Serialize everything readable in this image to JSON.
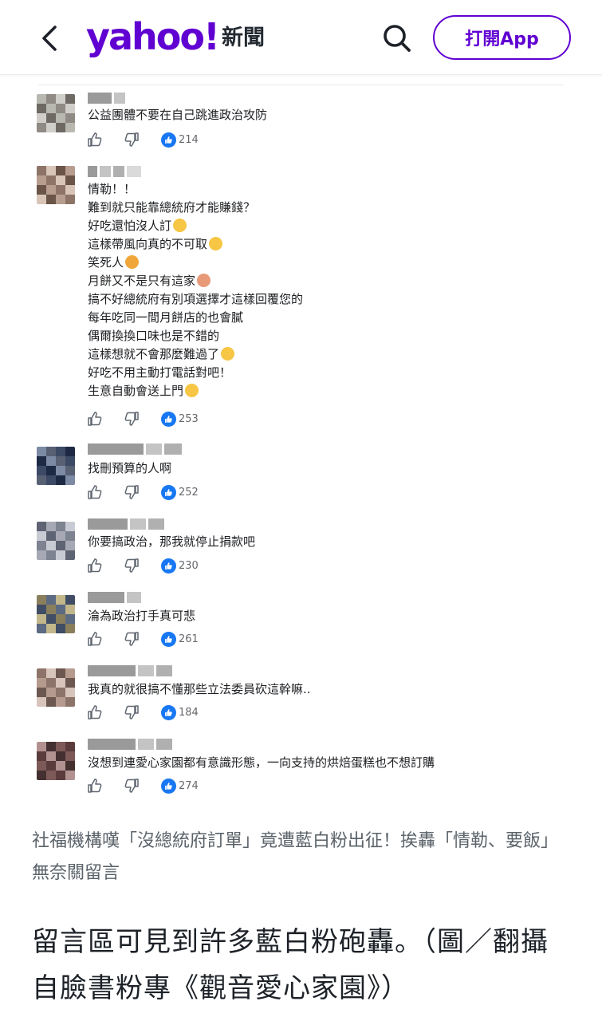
{
  "header": {
    "logo_text": "yahoo!",
    "logo_suffix": "新聞",
    "open_app_label": "打開App",
    "brand_color": "#6001d2",
    "icons": [
      "chevron-left-icon",
      "search-icon"
    ]
  },
  "comments": [
    {
      "lines": [
        "公益團體不要在自己跳進政治攻防"
      ],
      "reaction_count": "214"
    },
    {
      "lines": [
        "情勒！！",
        "難到就只能靠總統府才能賺錢？",
        "好吃還怕沒人訂",
        "這樣帶風向真的不可取",
        "笑死人",
        "月餅又不是只有這家",
        "搞不好總統府有別項選擇才這樣回覆您的",
        "每年吃同一間月餅店的也會膩",
        "偶爾換換口味也是不錯的",
        "這樣想就不會那麼難過了",
        "好吃不用主動打電話對吧！",
        "生意自動會送上門"
      ],
      "reaction_count": "253"
    },
    {
      "lines": [
        "找刪預算的人啊"
      ],
      "reaction_count": "252"
    },
    {
      "lines": [
        "你要搞政治，那我就停止捐款吧"
      ],
      "reaction_count": "230"
    },
    {
      "lines": [
        "淪為政治打手真可悲"
      ],
      "reaction_count": "261"
    },
    {
      "lines": [
        "我真的就很搞不懂那些立法委員砍這幹嘛.."
      ],
      "reaction_count": "184"
    },
    {
      "lines": [
        "沒想到連愛心家園都有意識形態，一向支持的烘焙蛋糕也不想訂購"
      ],
      "reaction_count": "274"
    }
  ],
  "caption": "社福機構嘆「沒總統府訂單」竟遭藍白粉出征！挨轟「情勒、要飯」無奈關留言",
  "headline": "留言區可見到許多藍白粉砲轟。（圖／翻攝自臉書粉專《觀音愛心家園》）"
}
